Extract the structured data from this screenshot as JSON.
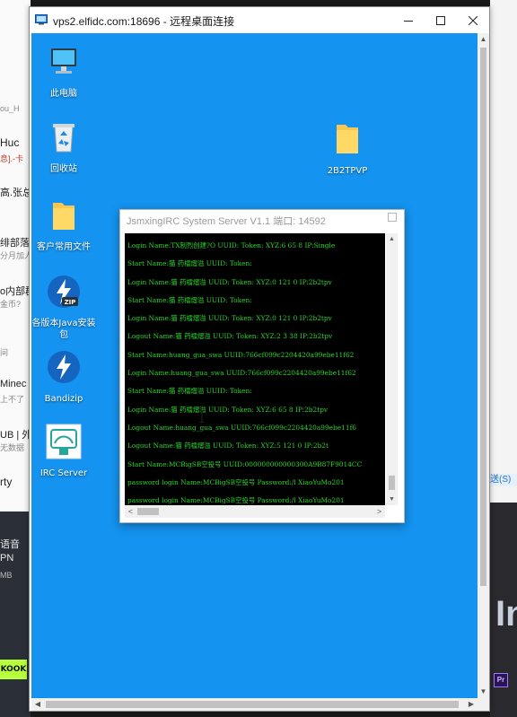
{
  "background_left": {
    "fragments": [
      "ou_H",
      "Huc",
      "息].-卡",
      "高.张总",
      "绯部落",
      "分月加人",
      "o内部群",
      "金币?",
      "间",
      "Minec",
      "上不了",
      "UB | 外",
      "无数据",
      "rty",
      "语音",
      "PN",
      "MB"
    ],
    "app_label": "KOOK"
  },
  "background_right": {
    "link_fragment": "送(S)",
    "big_letters": "In",
    "pr_icon": "Pr"
  },
  "rdp_window": {
    "title": "vps2.elfidc.com:18696 - 远程桌面连接"
  },
  "desktop_icons": [
    {
      "name": "this-pc",
      "label": "此电脑"
    },
    {
      "name": "recycle-bin",
      "label": "回收站"
    },
    {
      "name": "customer-files",
      "label": "客户常用文件"
    },
    {
      "name": "java-installer",
      "label": "各版本Java安装包"
    },
    {
      "name": "bandizip",
      "label": "Bandizip"
    },
    {
      "name": "irc-server",
      "label": "IRC Server"
    },
    {
      "name": "2b2tpvp",
      "label": "2B2TPVP"
    }
  ],
  "irc_window": {
    "title": "JsmxingIRC System Server V1.1 端口: 14592",
    "log_lines": [
      "Login Name:TX制烈创建?O UUID: Token: XYZ:6 65 8 IP:Single",
      "Start Name:猫  药檑熠溢 UUID: Token:",
      "Login Name:猫  药檑熠溢 UUID: Token: XYZ:0 121 0 IP:2b2tpv",
      "Start Name:猫  药檑熠溢 UUID: Token:",
      "Login Name:猫  药檑熠溢 UUID: Token: XYZ:0 121 0 IP:2b2tpv",
      "Logout Name:猫  药檑熠溢 UUID: Token: XYZ:2 3 38 IP:2b2tpv",
      "Start Name:huang_gua_swa UUID:766cf099c2204420a99ebe11f62",
      "Login Name:huang_gua_swa UUID:766cf099c2204420a99ebe11f62",
      "Start Name:猫  药檑熠溢 UUID: Token:",
      "Login Name:猫  药檑熠溢 UUID: Token: XYZ:6 65 8 IP:2b2tpv",
      "Logout Name:huang_gua_swa UUID:766cf099c2204420a99ebe11f6",
      "Logout Name:猫  药檑熠溢 UUID: Token: XYZ:5 121 0 IP:2b2t",
      "Start Name:MCBigSB空投号 UUID:000000000000300A9B87F9014CC",
      "password login Name:MCBigSB空投号 Password:/l XiaoYuMo201",
      "password login Name:MCBigSB空投号 Password:/l XiaoYuMo201"
    ]
  },
  "colors": {
    "desktop_blue": "#1493f0",
    "log_text_green": "#2bd52b",
    "log_background": "#000000"
  }
}
